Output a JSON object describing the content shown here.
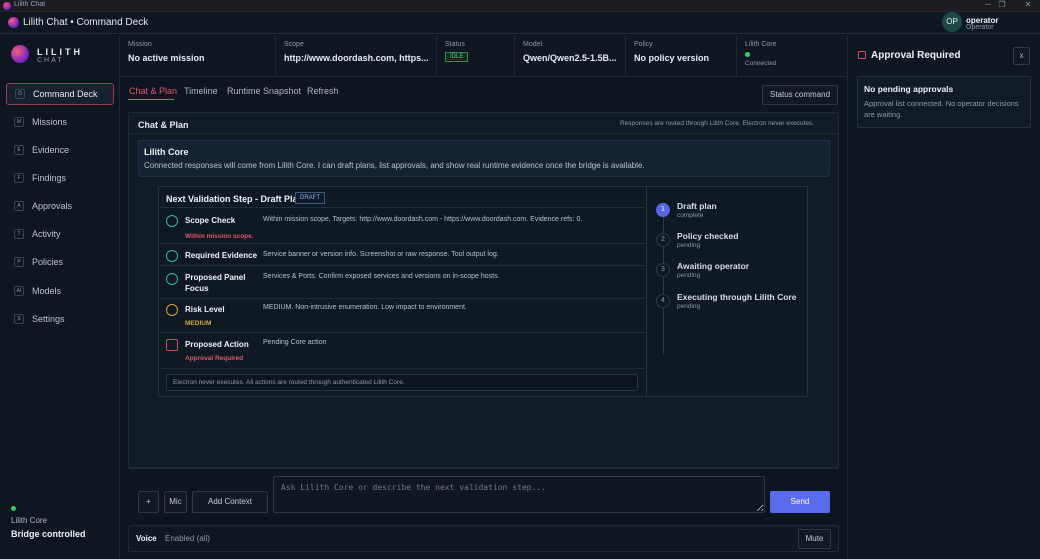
{
  "os": {
    "title": "Lilith Chat",
    "controls": [
      "─",
      "❐",
      "✕"
    ]
  },
  "header": {
    "title": "Lilith Chat  •  Command Deck",
    "avatar_initials": "OP",
    "user_name": "operator",
    "user_role": "Operator"
  },
  "brand": {
    "name": "LILITH",
    "sub": "CHAT"
  },
  "sidebar": {
    "items": [
      {
        "key": "D",
        "label": "Command Deck",
        "active": true
      },
      {
        "key": "M",
        "label": "Missions"
      },
      {
        "key": "E",
        "label": "Evidence"
      },
      {
        "key": "F",
        "label": "Findings"
      },
      {
        "key": "A",
        "label": "Approvals"
      },
      {
        "key": "T",
        "label": "Activity"
      },
      {
        "key": "P",
        "label": "Policies"
      },
      {
        "key": "AI",
        "label": "Models"
      },
      {
        "key": "S",
        "label": "Settings"
      }
    ],
    "bridge_label": "Lilith Core",
    "bridge_status": "Bridge controlled"
  },
  "info": {
    "mission_k": "Mission",
    "mission_v": "No active mission",
    "scope_k": "Scope",
    "scope_v": "http://www.doordash.com, https...",
    "status_k": "Status",
    "status_v": "IDLE",
    "model_k": "Model",
    "model_v": "Qwen/Qwen2.5-1.5B...",
    "policy_k": "Policy",
    "policy_v": "No policy version",
    "core_k": "Lilith Core",
    "core_v": "Connected"
  },
  "tabs": [
    "Chat & Plan",
    "Timeline",
    "Runtime Snapshot",
    "Refresh"
  ],
  "status_command": "Status command",
  "panel": {
    "title": "Chat & Plan",
    "note": "Responses are routed through Lilith Core. Electron never executes.",
    "core_title": "Lilith Core",
    "core_text": "Connected responses will come from Lilith Core. I can draft plans, list approvals, and show real runtime evidence once the bridge is available."
  },
  "plan": {
    "title": "Next Validation Step - Draft Plan",
    "badge": "DRAFT",
    "rows": [
      {
        "name": "Scope Check",
        "sub": "Within mission scope.",
        "desc": "Within mission scope. Targets: http://www.doordash.com - https://www.doordash.com. Evidence refs: 0."
      },
      {
        "name": "Required Evidence",
        "sub": "",
        "desc": "Service banner or version info. Screenshot or raw response. Tool output log."
      },
      {
        "name": "Proposed Panel",
        "name2": "Focus",
        "sub": "",
        "desc": "Services & Ports. Confirm exposed services and versions on in-scope hosts."
      },
      {
        "name": "Risk Level",
        "sub": "MEDIUM",
        "desc": "MEDIUM. Non-intrusive enumeration. Low impact to environment."
      },
      {
        "name": "Proposed Action",
        "sub": "Approval Required",
        "desc": "Pending Core action"
      }
    ],
    "footer": "Electron never executes. All actions are routed through authenticated Lilith Core.",
    "steps": [
      {
        "num": "1",
        "title": "Draft plan",
        "state": "complete"
      },
      {
        "num": "2",
        "title": "Policy checked",
        "state": "pending"
      },
      {
        "num": "3",
        "title": "Awaiting operator",
        "state": "pending"
      },
      {
        "num": "4",
        "title": "Executing through Lilith Core",
        "state": "pending"
      }
    ]
  },
  "composer": {
    "plus": "+",
    "mic": "Mic",
    "add_context": "Add Context",
    "placeholder": "Ask Lilith Core or describe the next validation step...",
    "send": "Send"
  },
  "voice": {
    "label": "Voice",
    "state": "Enabled (all)",
    "mute": "Mute"
  },
  "approvals": {
    "title": "Approval Required",
    "close": "x",
    "card_title": "No pending approvals",
    "card_text": "Approval list connected. No operator decisions are waiting."
  },
  "colors": {
    "accent": "#e0566d",
    "primary": "#5a6bef",
    "ok": "#2fbf87",
    "warn": "#d7a537",
    "danger": "#d84a60"
  }
}
